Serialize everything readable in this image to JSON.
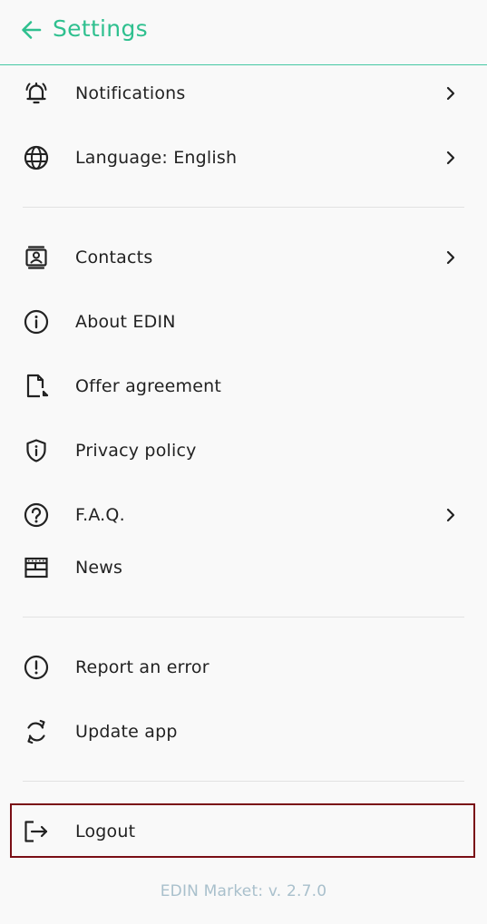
{
  "header": {
    "title": "Settings",
    "back_icon": "arrow-left-icon",
    "accent_color": "#2fc08f"
  },
  "menu": {
    "notifications": {
      "label": "Notifications",
      "icon": "bell-ringing-icon",
      "has_chevron": true
    },
    "language": {
      "label": "Language: English",
      "icon": "globe-icon",
      "has_chevron": true
    },
    "contacts": {
      "label": "Contacts",
      "icon": "contact-card-icon",
      "has_chevron": true
    },
    "about": {
      "label": "About EDIN",
      "icon": "info-icon",
      "has_chevron": false
    },
    "offer": {
      "label": "Offer agreement",
      "icon": "document-icon",
      "has_chevron": false
    },
    "privacy": {
      "label": "Privacy policy",
      "icon": "shield-info-icon",
      "has_chevron": false
    },
    "faq": {
      "label": "F.A.Q.",
      "icon": "question-icon",
      "has_chevron": true
    },
    "news": {
      "label": "News",
      "icon": "newspaper-icon",
      "has_chevron": false
    },
    "report": {
      "label": "Report an error",
      "icon": "alert-icon",
      "has_chevron": false
    },
    "update": {
      "label": "Update app",
      "icon": "refresh-icon",
      "has_chevron": false
    },
    "logout": {
      "label": "Logout",
      "icon": "logout-icon",
      "has_chevron": false,
      "highlight_color": "#7a0e15"
    }
  },
  "footer": {
    "version": "EDIN Market: v. 2.7.0"
  }
}
